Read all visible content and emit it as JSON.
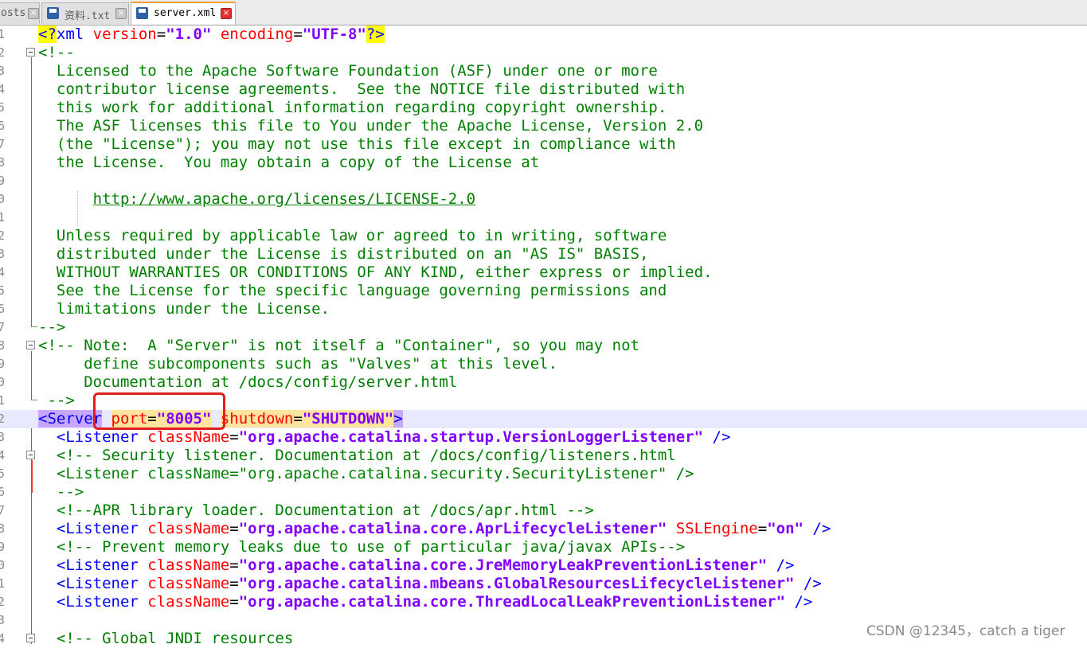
{
  "tabs": [
    {
      "label": "osts",
      "active": false
    },
    {
      "label": "资料.txt",
      "active": false
    },
    {
      "label": "server.xml",
      "active": true
    }
  ],
  "lines": [
    {
      "n": "1",
      "segs": [
        [
          "hl-yellow tag",
          "<?"
        ],
        [
          "tag",
          "xml "
        ],
        [
          "attr",
          "version"
        ],
        [
          "plain",
          "="
        ],
        [
          "val",
          "\"1.0\""
        ],
        [
          "plain",
          " "
        ],
        [
          "attr",
          "encoding"
        ],
        [
          "plain",
          "="
        ],
        [
          "val",
          "\"UTF-8\""
        ],
        [
          "hl-yellow tag",
          "?>"
        ]
      ]
    },
    {
      "n": "2",
      "segs": [
        [
          "cmt",
          "<!--"
        ]
      ]
    },
    {
      "n": "3",
      "segs": [
        [
          "cmt",
          "  Licensed to the Apache Software Foundation (ASF) under one or more"
        ]
      ]
    },
    {
      "n": "4",
      "segs": [
        [
          "cmt",
          "  contributor license agreements.  See the NOTICE file distributed with"
        ]
      ]
    },
    {
      "n": "5",
      "segs": [
        [
          "cmt",
          "  this work for additional information regarding copyright ownership."
        ]
      ]
    },
    {
      "n": "6",
      "segs": [
        [
          "cmt",
          "  The ASF licenses this file to You under the Apache License, Version 2.0"
        ]
      ]
    },
    {
      "n": "7",
      "segs": [
        [
          "cmt",
          "  (the \"License\"); you may not use this file except in compliance with"
        ]
      ]
    },
    {
      "n": "8",
      "segs": [
        [
          "cmt",
          "  the License.  You may obtain a copy of the License at"
        ]
      ]
    },
    {
      "n": "9",
      "segs": []
    },
    {
      "n": "0",
      "segs": [
        [
          "cmt",
          "      "
        ],
        [
          "url",
          "http://www.apache.org/licenses/LICENSE-2.0"
        ]
      ]
    },
    {
      "n": "1",
      "segs": []
    },
    {
      "n": "2",
      "segs": [
        [
          "cmt",
          "  Unless required by applicable law or agreed to in writing, software"
        ]
      ]
    },
    {
      "n": "3",
      "segs": [
        [
          "cmt",
          "  distributed under the License is distributed on an \"AS IS\" BASIS,"
        ]
      ]
    },
    {
      "n": "4",
      "segs": [
        [
          "cmt",
          "  WITHOUT WARRANTIES OR CONDITIONS OF ANY KIND, either express or implied."
        ]
      ]
    },
    {
      "n": "5",
      "segs": [
        [
          "cmt",
          "  See the License for the specific language governing permissions and"
        ]
      ]
    },
    {
      "n": "6",
      "segs": [
        [
          "cmt",
          "  limitations under the License."
        ]
      ]
    },
    {
      "n": "7",
      "segs": [
        [
          "cmt",
          "-->"
        ]
      ]
    },
    {
      "n": "8",
      "segs": [
        [
          "cmt",
          "<!-- Note:  A \"Server\" is not itself a \"Container\", so you may not"
        ]
      ]
    },
    {
      "n": "9",
      "segs": [
        [
          "cmt",
          "     define subcomponents such as \"Valves\" at this level."
        ]
      ]
    },
    {
      "n": "0",
      "segs": [
        [
          "cmt",
          "     Documentation at /docs/config/server.html"
        ]
      ]
    },
    {
      "n": "1",
      "segs": [
        [
          "cmt",
          " -->"
        ]
      ]
    },
    {
      "n": "2",
      "segs": [
        [
          "hl-purple tag",
          "<Server"
        ],
        [
          "plain",
          " "
        ],
        [
          "hl-orange attr",
          "port"
        ],
        [
          "hl-orange plain",
          "="
        ],
        [
          "hl-orange val",
          "\"8005\""
        ],
        [
          "plain",
          " "
        ],
        [
          "hl-orange attr",
          "shutdown"
        ],
        [
          "hl-orange plain",
          "="
        ],
        [
          "hl-orange val",
          "\"SHUTDOWN\""
        ],
        [
          "hl-purple tag",
          ">"
        ]
      ],
      "current": true
    },
    {
      "n": "3",
      "segs": [
        [
          "plain",
          "  "
        ],
        [
          "tag",
          "<Listener "
        ],
        [
          "attr",
          "className"
        ],
        [
          "plain",
          "="
        ],
        [
          "val",
          "\"org.apache.catalina.startup.VersionLoggerListener\""
        ],
        [
          "plain",
          " "
        ],
        [
          "tag",
          "/>"
        ]
      ]
    },
    {
      "n": "4",
      "segs": [
        [
          "cmt",
          "  <!-- Security listener. Documentation at /docs/config/listeners.html"
        ]
      ]
    },
    {
      "n": "5",
      "segs": [
        [
          "cmt",
          "  <Listener className=\"org.apache.catalina.security.SecurityListener\" />"
        ]
      ]
    },
    {
      "n": "6",
      "segs": [
        [
          "cmt",
          "  -->"
        ]
      ]
    },
    {
      "n": "7",
      "segs": [
        [
          "cmt",
          "  <!--APR library loader. Documentation at /docs/apr.html -->"
        ]
      ]
    },
    {
      "n": "8",
      "segs": [
        [
          "plain",
          "  "
        ],
        [
          "tag",
          "<Listener "
        ],
        [
          "attr",
          "className"
        ],
        [
          "plain",
          "="
        ],
        [
          "val",
          "\"org.apache.catalina.core.AprLifecycleListener\""
        ],
        [
          "plain",
          " "
        ],
        [
          "attr",
          "SSLEngine"
        ],
        [
          "plain",
          "="
        ],
        [
          "val",
          "\"on\""
        ],
        [
          "plain",
          " "
        ],
        [
          "tag",
          "/>"
        ]
      ]
    },
    {
      "n": "9",
      "segs": [
        [
          "cmt",
          "  <!-- Prevent memory leaks due to use of particular java/javax APIs-->"
        ]
      ]
    },
    {
      "n": "0",
      "segs": [
        [
          "plain",
          "  "
        ],
        [
          "tag",
          "<Listener "
        ],
        [
          "attr",
          "className"
        ],
        [
          "plain",
          "="
        ],
        [
          "val",
          "\"org.apache.catalina.core.JreMemoryLeakPreventionListener\""
        ],
        [
          "plain",
          " "
        ],
        [
          "tag",
          "/>"
        ]
      ]
    },
    {
      "n": "1",
      "segs": [
        [
          "plain",
          "  "
        ],
        [
          "tag",
          "<Listener "
        ],
        [
          "attr",
          "className"
        ],
        [
          "plain",
          "="
        ],
        [
          "val",
          "\"org.apache.catalina.mbeans.GlobalResourcesLifecycleListener\""
        ],
        [
          "plain",
          " "
        ],
        [
          "tag",
          "/>"
        ]
      ]
    },
    {
      "n": "2",
      "segs": [
        [
          "plain",
          "  "
        ],
        [
          "tag",
          "<Listener "
        ],
        [
          "attr",
          "className"
        ],
        [
          "plain",
          "="
        ],
        [
          "val",
          "\"org.apache.catalina.core.ThreadLocalLeakPreventionListener\""
        ],
        [
          "plain",
          " "
        ],
        [
          "tag",
          "/>"
        ]
      ]
    },
    {
      "n": "3",
      "segs": []
    },
    {
      "n": "4",
      "segs": [
        [
          "cmt",
          "  <!-- Global JNDI resources"
        ]
      ]
    }
  ],
  "watermark": "CSDN @12345，catch a tiger",
  "colors": {
    "comment": "#008000",
    "tag": "#0000ff",
    "attribute": "#ff0000",
    "value": "#8000ff",
    "highlight": "#ffff00",
    "annotation_box": "#e02020"
  }
}
